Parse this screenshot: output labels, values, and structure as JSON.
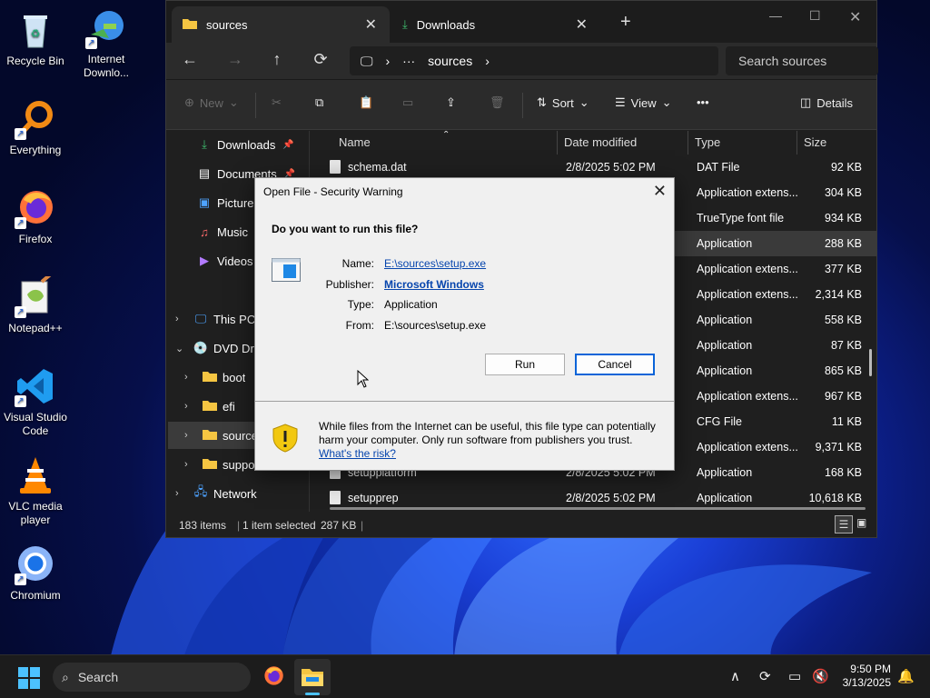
{
  "desktop": {
    "icons": [
      {
        "label": "Recycle Bin"
      },
      {
        "label": "Internet Downlo..."
      },
      {
        "label": "Everything"
      },
      {
        "label": "Firefox"
      },
      {
        "label": "Notepad++"
      },
      {
        "label": "Visual Studio Code"
      },
      {
        "label": "VLC media player"
      },
      {
        "label": "Chromium"
      }
    ]
  },
  "explorer": {
    "tabs": [
      {
        "label": "sources",
        "icon": "folder-icon"
      },
      {
        "label": "Downloads",
        "icon": "download-icon"
      }
    ],
    "address": {
      "ellipsis": "···",
      "crumb": "sources"
    },
    "search_placeholder": "Search sources",
    "toolbar": {
      "new": "New",
      "sort": "Sort",
      "view": "View",
      "more": "•••",
      "details": "Details"
    },
    "nav": {
      "items": [
        {
          "label": "Downloads"
        },
        {
          "label": "Documents"
        },
        {
          "label": "Pictures"
        },
        {
          "label": "Music"
        },
        {
          "label": "Videos"
        },
        {
          "label": "This PC"
        },
        {
          "label": "DVD Drive"
        },
        {
          "label": "boot"
        },
        {
          "label": "efi"
        },
        {
          "label": "sources"
        },
        {
          "label": "support"
        },
        {
          "label": "Network"
        }
      ]
    },
    "columns": {
      "name": "Name",
      "date": "Date modified",
      "type": "Type",
      "size": "Size"
    },
    "files": [
      {
        "name": "schema.dat",
        "date": "2/8/2025 5:02 PM",
        "type": "DAT File",
        "size": "92 KB"
      },
      {
        "name": "",
        "date": "",
        "type": "Application extens...",
        "size": "304 KB"
      },
      {
        "name": "",
        "date": "",
        "type": "TrueType font file",
        "size": "934 KB"
      },
      {
        "name": "",
        "date": "",
        "type": "Application",
        "size": "288 KB"
      },
      {
        "name": "",
        "date": "",
        "type": "Application extens...",
        "size": "377 KB"
      },
      {
        "name": "",
        "date": "",
        "type": "Application extens...",
        "size": "2,314 KB"
      },
      {
        "name": "",
        "date": "",
        "type": "Application",
        "size": "558 KB"
      },
      {
        "name": "",
        "date": "",
        "type": "Application",
        "size": "87 KB"
      },
      {
        "name": "",
        "date": "",
        "type": "Application",
        "size": "865 KB"
      },
      {
        "name": "",
        "date": "",
        "type": "Application extens...",
        "size": "967 KB"
      },
      {
        "name": "",
        "date": "",
        "type": "CFG File",
        "size": "11 KB"
      },
      {
        "name": "",
        "date": "",
        "type": "Application extens...",
        "size": "9,371 KB"
      },
      {
        "name": "setupplatform",
        "date": "2/8/2025 5:02 PM",
        "type": "Application",
        "size": "168 KB"
      },
      {
        "name": "setupprep",
        "date": "2/8/2025 5:02 PM",
        "type": "Application",
        "size": "10,618 KB"
      }
    ],
    "status": {
      "count": "183 items",
      "selected": "1 item selected",
      "size": "287 KB"
    }
  },
  "dialog": {
    "title": "Open File - Security Warning",
    "question": "Do you want to run this file?",
    "fields": {
      "name_label": "Name:",
      "name_value": "E:\\sources\\setup.exe",
      "publisher_label": "Publisher:",
      "publisher_value": "Microsoft Windows",
      "type_label": "Type:",
      "type_value": "Application",
      "from_label": "From:",
      "from_value": "E:\\sources\\setup.exe"
    },
    "run_button": "Run",
    "cancel_button": "Cancel",
    "warning_text": "While files from the Internet can be useful, this file type can potentially harm your computer. Only run software from publishers you trust.",
    "risk_link": "What's the risk?"
  },
  "taskbar": {
    "search": "Search",
    "time": "9:50 PM",
    "date": "3/13/2025"
  },
  "colors": {
    "accent": "#0a64d8",
    "link": "#0645ad",
    "shield": "#f2c811"
  }
}
